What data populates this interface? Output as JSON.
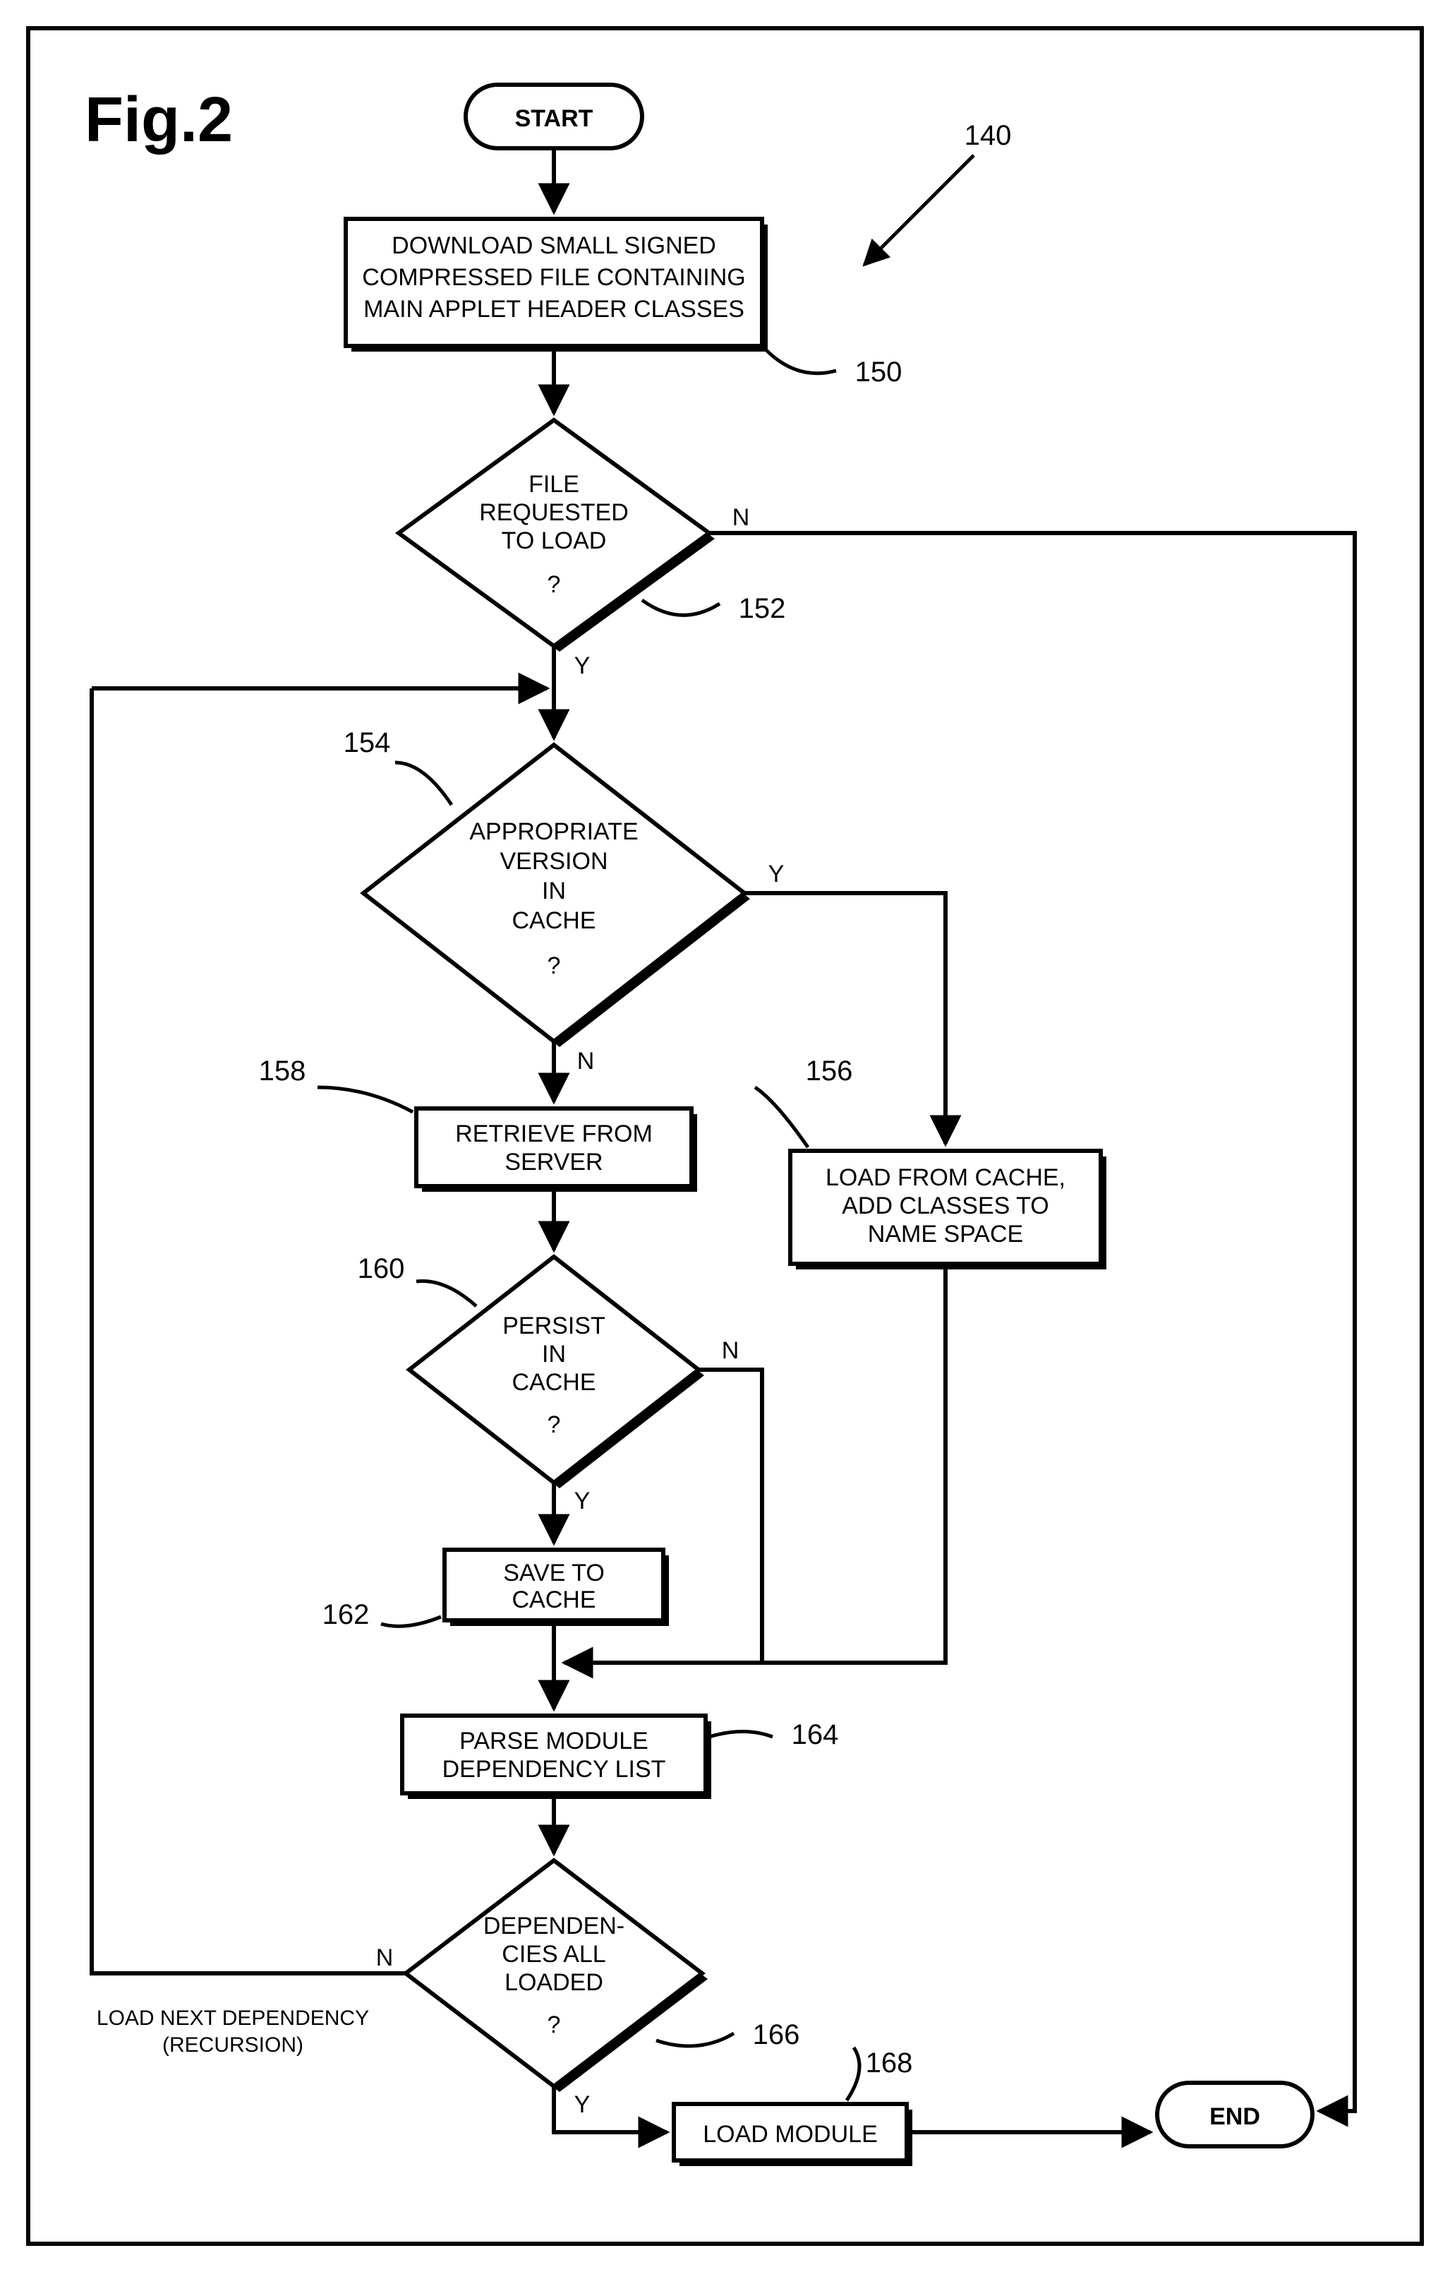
{
  "figure_label": "Fig.2",
  "terminals": {
    "start": "START",
    "end": "END"
  },
  "process": {
    "download": [
      "DOWNLOAD SMALL SIGNED",
      "COMPRESSED FILE CONTAINING",
      "MAIN APPLET HEADER CLASSES"
    ],
    "retrieve": [
      "RETRIEVE FROM",
      "SERVER"
    ],
    "load_cache": [
      "LOAD FROM CACHE,",
      "ADD CLASSES TO",
      "NAME SPACE"
    ],
    "save": [
      "SAVE TO",
      "CACHE"
    ],
    "parse": [
      "PARSE MODULE",
      "DEPENDENCY LIST"
    ],
    "load_module": "LOAD MODULE"
  },
  "decision": {
    "file_req": [
      "FILE",
      "REQUESTED",
      "TO LOAD",
      "?"
    ],
    "version": [
      "APPROPRIATE",
      "VERSION",
      "IN",
      "CACHE",
      "?"
    ],
    "persist": [
      "PERSIST",
      "IN",
      "CACHE",
      "?"
    ],
    "deps": [
      "DEPENDEN-",
      "CIES ALL",
      "LOADED",
      "?"
    ]
  },
  "edge": {
    "Y": "Y",
    "N": "N",
    "recursion1": "LOAD NEXT DEPENDENCY",
    "recursion2": "(RECURSION)"
  },
  "refs": {
    "r140": "140",
    "r150": "150",
    "r152": "152",
    "r154": "154",
    "r156": "156",
    "r158": "158",
    "r160": "160",
    "r162": "162",
    "r164": "164",
    "r166": "166",
    "r168": "168"
  }
}
